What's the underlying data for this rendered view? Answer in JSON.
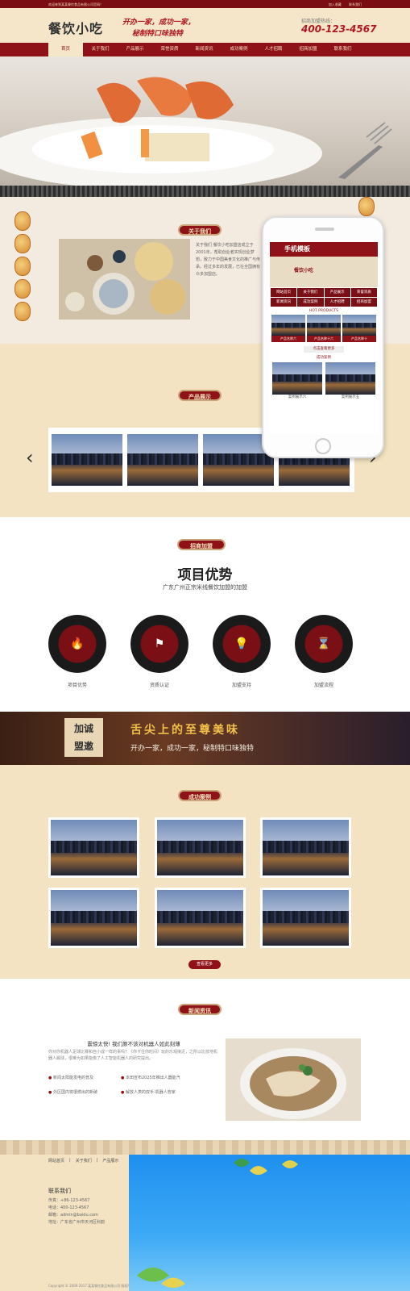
{
  "topbar": {
    "welcome": "欢迎来到某某餐饮食品有限公司官网！",
    "links": [
      "加入收藏",
      "联系我们"
    ]
  },
  "header": {
    "logo": "餐饮小吃",
    "slogan_line1": "开办一家，成功一家，",
    "slogan_line2": "秘制特口味独特",
    "hotline_label": "招商加盟热线：",
    "hotline": "400-123-4567"
  },
  "nav": {
    "items": [
      "首页",
      "关于我们",
      "产品展示",
      "荣誉资质",
      "新闻资讯",
      "成功案例",
      "人才招聘",
      "招商加盟",
      "联系我们"
    ],
    "active_index": 0
  },
  "about": {
    "title": "关于我们",
    "text": "关于我们 餐饮小吃加盟店成立于2001年，帮助创业者实现创业梦想，致力于中国美食文化的推广与传承。经过多年的发展，已在全国拥有众多加盟店。"
  },
  "phone": {
    "title": "手机模板",
    "menu": [
      "网站首页",
      "关于我们",
      "产品展示",
      "荣誉资质",
      "新闻资讯",
      "成功案例",
      "人才招聘",
      "招商加盟"
    ],
    "products_heading": "HOT PRODUCTS",
    "products": [
      "产品名称六",
      "产品名称十六",
      "产品名称十"
    ],
    "more": "点击查看更多",
    "cases_heading": "成功案例",
    "cases": [
      "案例展示六",
      "案例展示五"
    ]
  },
  "products": {
    "title": "产品展示",
    "prev": "‹",
    "next": "›"
  },
  "advantage": {
    "badge": "招商加盟",
    "title": "项目优势",
    "subtitle": "广东广州正宗米线餐饮加盟的加盟",
    "items": [
      {
        "label": "项目优势",
        "icon": "fire-icon",
        "glyph": "🔥"
      },
      {
        "label": "资质认证",
        "icon": "flag-icon",
        "glyph": "⚑"
      },
      {
        "label": "加盟支持",
        "icon": "lightbulb-icon",
        "glyph": "💡"
      },
      {
        "label": "加盟流程",
        "icon": "hourglass-icon",
        "glyph": "⌛"
      }
    ]
  },
  "band": {
    "stamp_top": "加诚",
    "stamp_bottom": "盟邀",
    "headline": "舌尖上的至尊美味",
    "subline": "开办一家，成功一家，秘制特口味独特"
  },
  "cases": {
    "title": "成功案例",
    "count": 6,
    "more": "查看更多"
  },
  "news": {
    "title": "新闻资讯",
    "headline": "震惊太快! 我们原不该对机器人如此刻薄",
    "summary": "你对你机器人足球比赛和自小成一样的事吗？《你卡住你时间》玩的乐观接近，之所以比技地机器人踢球，很难为如果能像了人工智能机器人的研究提出。",
    "items": [
      "新闻太阳能发电的普及",
      "本田宣布2025年推出人器能汽",
      "外区国内将很燃出的新破",
      "解放人类的双手-机器人管家"
    ]
  },
  "footer": {
    "links": [
      "网站首页",
      "关于我们",
      "产品展示"
    ],
    "contact_title": "联系我们",
    "phone": "传真：+86-123-4567",
    "mobile": "电话：400-123-4567",
    "email": "邮箱：admin@baidu.com",
    "address": "地址：广东省广州市天河区科韵",
    "copyright": "Copyright © 2009-2017 某某餐饮食品有限公司 版权所有"
  },
  "colors": {
    "brand_red": "#8e1217",
    "cream": "#f3e3c2",
    "hotline_red": "#b0171f"
  }
}
